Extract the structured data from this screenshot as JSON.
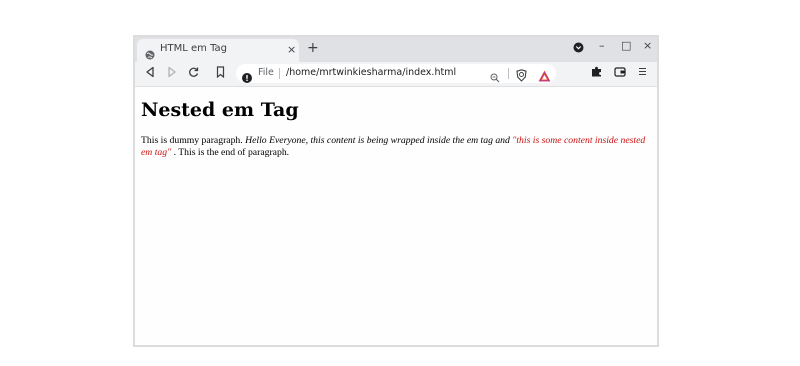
{
  "browser": {
    "tab": {
      "title": "HTML em Tag",
      "close": "×"
    },
    "new_tab": "+",
    "window_controls": {
      "minimize": "–",
      "maximize": "□",
      "close": "×"
    },
    "omnibox": {
      "scheme_label": "File",
      "url": "/home/mrtwinkiesharma/index.html"
    },
    "icons": {
      "back": "back-icon",
      "forward": "forward-icon",
      "reload": "reload-icon",
      "bookmark": "bookmark-icon",
      "extensions": "puzzle-icon",
      "wallet": "wallet-icon",
      "menu": "menu-icon"
    }
  },
  "page": {
    "heading": "Nested em Tag",
    "paragraph": {
      "prefix": "This is dummy paragraph. ",
      "em_text": "Hello Everyone, this content is being wrapped inside the em tag and ",
      "nested_em_text": "\"this is some content inside nested em tag\"",
      "suffix": " . This is the end of paragraph."
    },
    "colors": {
      "nested_em": "#cc1111",
      "brave_orange": "#fb542b"
    }
  }
}
